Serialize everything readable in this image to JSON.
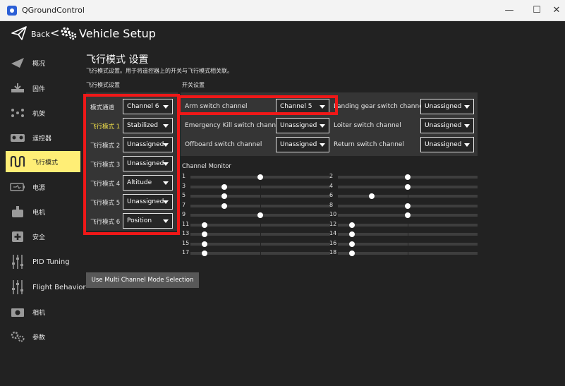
{
  "window": {
    "app_title": "QGroundControl",
    "minimize": "—",
    "maximize": "☐",
    "close": "✕",
    "accent": "#2c5fd6"
  },
  "topbar": {
    "back_label": "Back",
    "separator": "<",
    "title": "Vehicle Setup"
  },
  "sidebar": {
    "items": [
      {
        "label": "概况",
        "icon": "paper-plane-icon"
      },
      {
        "label": "固件",
        "icon": "firmware-download-icon"
      },
      {
        "label": "机架",
        "icon": "airframe-icon"
      },
      {
        "label": "遥控器",
        "icon": "radio-controller-icon"
      },
      {
        "label": "飞行模式",
        "icon": "flight-modes-icon",
        "active": true
      },
      {
        "label": "电源",
        "icon": "battery-icon"
      },
      {
        "label": "电机",
        "icon": "motor-icon"
      },
      {
        "label": "安全",
        "icon": "safety-icon"
      },
      {
        "label": "PID Tuning",
        "icon": "sliders-icon"
      },
      {
        "label": "Flight Behavior",
        "icon": "sliders-icon"
      },
      {
        "label": "相机",
        "icon": "camera-icon"
      },
      {
        "label": "参数",
        "icon": "parameters-gear-icon"
      }
    ],
    "active_color": "#ffee76"
  },
  "content": {
    "heading": "飞行模式 设置",
    "description": "飞行模式设置。用于将遥控器上的开关与飞行模式相关联。",
    "left_section_title": "飞行模式设置",
    "right_section_title": "开关设置"
  },
  "flight_modes": {
    "mode_channel_label": "模式通道",
    "mode_channel_value": "Channel 6",
    "modes": [
      {
        "label": "飞行模式 1",
        "value": "Stabilized",
        "highlighted": true
      },
      {
        "label": "飞行模式 2",
        "value": "Unassigned"
      },
      {
        "label": "飞行模式 3",
        "value": "Unassigned"
      },
      {
        "label": "飞行模式 4",
        "value": "Altitude"
      },
      {
        "label": "飞行模式 5",
        "value": "Unassigned"
      },
      {
        "label": "飞行模式 6",
        "value": "Position"
      }
    ],
    "highlight_color": "#f5e34a"
  },
  "switches": {
    "arm": {
      "label": "Arm switch channel",
      "value": "Channel 5"
    },
    "landing_gear": {
      "label": "Landing gear switch channel",
      "value": "Unassigned"
    },
    "kill": {
      "label": "Emergency Kill switch channel",
      "value": "Unassigned"
    },
    "loiter": {
      "label": "Loiter switch channel",
      "value": "Unassigned"
    },
    "offboard": {
      "label": "Offboard switch channel",
      "value": "Unassigned"
    },
    "return": {
      "label": "Return switch channel",
      "value": "Unassigned"
    }
  },
  "channel_monitor": {
    "title": "Channel Monitor",
    "channels": [
      {
        "num": "1",
        "level": 0.5
      },
      {
        "num": "2",
        "level": 0.5
      },
      {
        "num": "3",
        "level": 0.24
      },
      {
        "num": "4",
        "level": 0.5
      },
      {
        "num": "5",
        "level": 0.24
      },
      {
        "num": "6",
        "level": 0.24
      },
      {
        "num": "7",
        "level": 0.24
      },
      {
        "num": "8",
        "level": 0.5
      },
      {
        "num": "9",
        "level": 0.5
      },
      {
        "num": "10",
        "level": 0.5
      },
      {
        "num": "11",
        "level": 0.1
      },
      {
        "num": "12",
        "level": 0.1
      },
      {
        "num": "13",
        "level": 0.1
      },
      {
        "num": "14",
        "level": 0.1
      },
      {
        "num": "15",
        "level": 0.1
      },
      {
        "num": "16",
        "level": 0.1
      },
      {
        "num": "17",
        "level": 0.1
      },
      {
        "num": "18",
        "level": 0.1
      }
    ]
  },
  "actions": {
    "multi_channel_button": "Use Multi Channel Mode Selection"
  },
  "annotation_color": "#ef1818"
}
